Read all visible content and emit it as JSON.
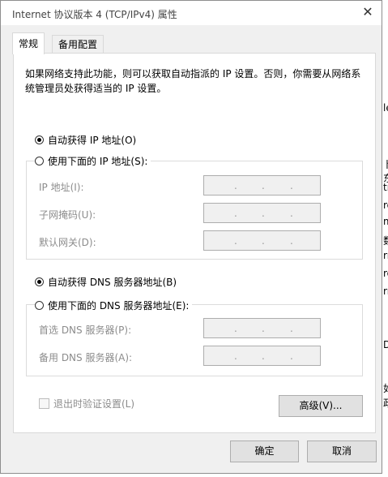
{
  "background": {
    "fragments": [
      "ro",
      "彡",
      "数",
      "址",
      "地",
      "ler",
      "卜东",
      "tro",
      "ro",
      "ma",
      "数",
      "rn",
      "ro",
      "rn",
      "))",
      "N:",
      "尔",
      "尔",
      "D)",
      "辩",
      "如",
      "政",
      "亘"
    ]
  },
  "dialog": {
    "title": "Internet 协议版本 4 (TCP/IPv4) 属性",
    "close_symbol": "✕",
    "tabs": [
      "常规",
      "备用配置"
    ],
    "description": "如果网络支持此功能，则可以获取自动指派的 IP 设置。否则，你需要从网络系统管理员处获得适当的 IP 设置。",
    "ip": {
      "auto_label": "自动获得 IP 地址(O)",
      "manual_label": "使用下面的 IP 地址(S):",
      "address_label": "IP 地址(I):",
      "mask_label": "子网掩码(U):",
      "gateway_label": "默认网关(D):",
      "dot": "."
    },
    "dns": {
      "auto_label": "自动获得 DNS 服务器地址(B)",
      "manual_label": "使用下面的 DNS 服务器地址(E):",
      "preferred_label": "首选 DNS 服务器(P):",
      "alternate_label": "备用 DNS 服务器(A):"
    },
    "validate_label": "退出时验证设置(L)",
    "advanced_button": "高级(V)...",
    "ok_button": "确定",
    "cancel_button": "取消"
  }
}
